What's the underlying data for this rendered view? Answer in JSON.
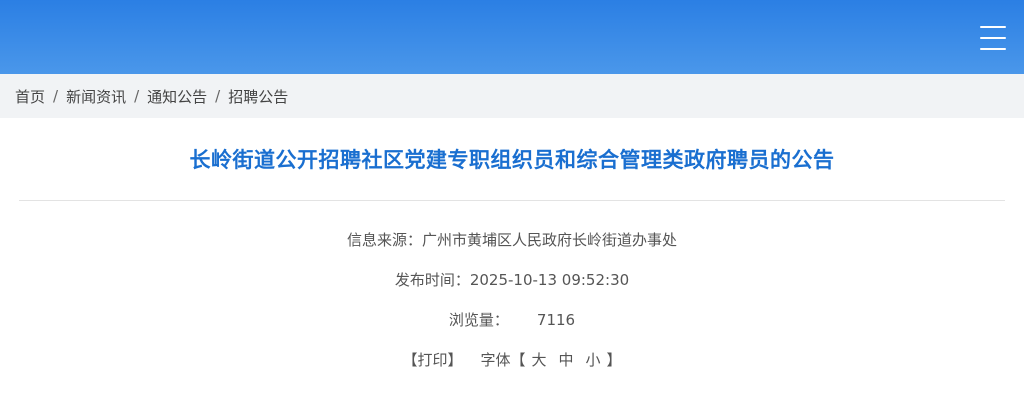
{
  "breadcrumb": {
    "items": [
      "首页",
      "新闻资讯",
      "通知公告",
      "招聘公告"
    ],
    "separator": "/"
  },
  "article": {
    "title": "长岭街道公开招聘社区党建专职组织员和综合管理类政府聘员的公告",
    "source_label": "信息来源：",
    "source_value": "广州市黄埔区人民政府长岭街道办事处",
    "publish_label": "发布时间：",
    "publish_value": "2025-10-13 09:52:30",
    "views_label": "浏览量：",
    "views_value": "7116"
  },
  "tools": {
    "print_label": "【打印】",
    "font_label": "字体【",
    "font_large": "大",
    "font_medium": "中",
    "font_small": "小",
    "font_close": "】"
  },
  "icons": {
    "menu": "hamburger-menu-icon"
  },
  "colors": {
    "header_top": "#2b7fe4",
    "header_bottom": "#4a97ea",
    "title": "#1a6fd0",
    "breadcrumb_bg": "#f1f3f5"
  }
}
